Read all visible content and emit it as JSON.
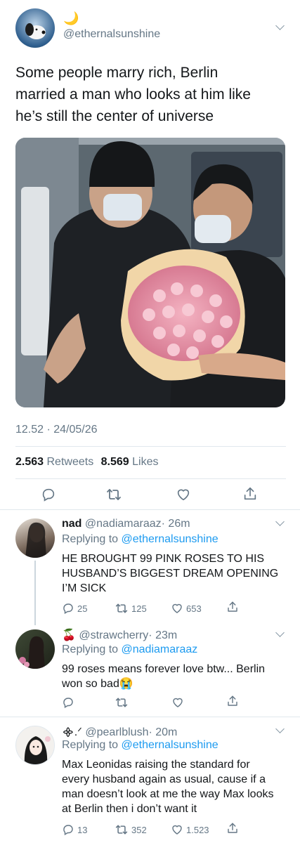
{
  "main_tweet": {
    "name_emoji": "🌙",
    "handle": "@ethernalsunshine",
    "text_lines": [
      "Some people marry rich, Berlin",
      "married a man who looks at him like",
      "he’s still the center of universe"
    ],
    "timestamp": "12.52 · 24/05/26",
    "retweets_count": "2.563",
    "retweets_label": "Retweets",
    "likes_count": "8.569",
    "likes_label": "Likes"
  },
  "replies": [
    {
      "name": "nad",
      "handle": "@nadiamaraaz",
      "time": "· 26m",
      "replying_prefix": "Replying to",
      "replying_to": "@ethernalsunshine",
      "text_lines": [
        "HE BROUGHT 99 PINK ROSES TO HIS",
        "HUSBAND’S BIGGEST DREAM OPENING",
        "I’M SICK"
      ],
      "replies_count": "25",
      "retweets_count": "125",
      "likes_count": "653"
    },
    {
      "name_emoji": "🍒",
      "handle": "@strawcherry",
      "time": "· 23m",
      "replying_prefix": "Replying to",
      "replying_to": "@nadiamaraaz",
      "text_lines": [
        "99 roses means forever love btw... Berlin",
        "won so bad"
      ],
      "trailing_emoji": "😭"
    },
    {
      "name_symbol": "᯽.ᐟ",
      "handle": "@pearlblush",
      "time": "· 20m",
      "replying_prefix": "Replying to",
      "replying_to": "@ethernalsunshine",
      "text_lines": [
        "Max Leonidas raising the standard for",
        "every husband again as usual, cause if a",
        "man doesn’t look at me the way Max looks",
        "at Berlin then i don’t want it"
      ],
      "replies_count": "13",
      "retweets_count": "352",
      "likes_count": "1.523"
    }
  ],
  "icons": [
    "reply-icon",
    "retweet-icon",
    "like-icon",
    "share-icon",
    "chevron-down-icon"
  ],
  "colors": {
    "link": "#1d9bf0",
    "secondary": "#657786",
    "divider": "#e1e8ed"
  }
}
